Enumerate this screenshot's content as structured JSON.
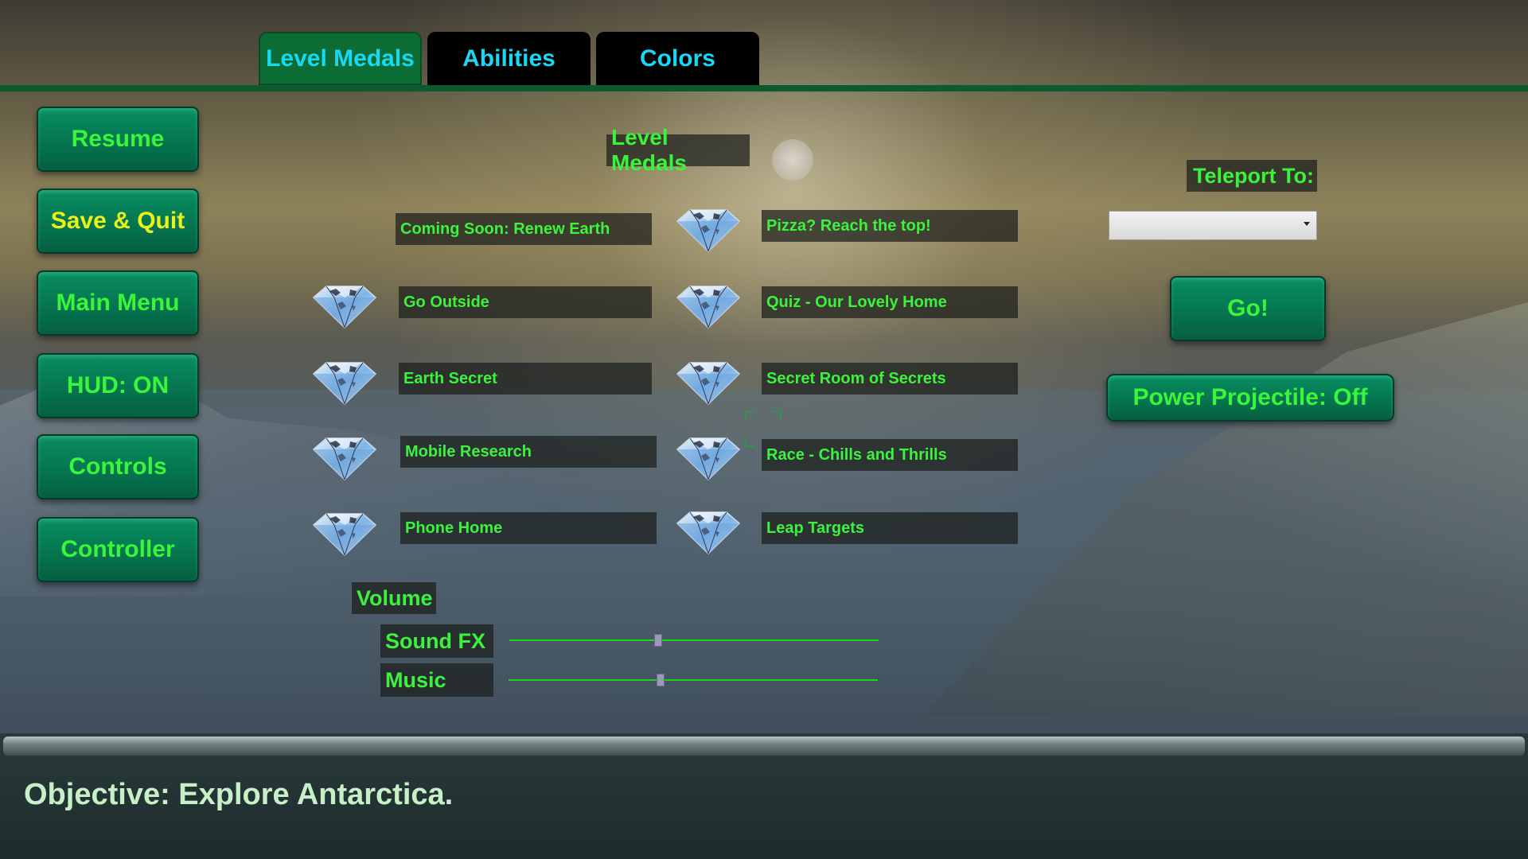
{
  "tabs": [
    {
      "label": "Level Medals",
      "active": true
    },
    {
      "label": "Abilities",
      "active": false
    },
    {
      "label": "Colors",
      "active": false
    }
  ],
  "side_menu": {
    "resume": "Resume",
    "save_quit": "Save & Quit",
    "main_menu": "Main Menu",
    "hud": "HUD: ON",
    "controls": "Controls",
    "controller": "Controller"
  },
  "medals": {
    "title": "Level Medals",
    "left": [
      {
        "label": "Coming Soon: Renew Earth",
        "earned": false
      },
      {
        "label": "Go Outside",
        "earned": true
      },
      {
        "label": "Earth Secret",
        "earned": true
      },
      {
        "label": "Mobile Research",
        "earned": true
      },
      {
        "label": "Phone Home",
        "earned": true
      }
    ],
    "right": [
      {
        "label": "Pizza? Reach the top!",
        "earned": true
      },
      {
        "label": "Quiz - Our Lovely Home",
        "earned": true
      },
      {
        "label": "Secret Room of Secrets",
        "earned": true
      },
      {
        "label": "Race - Chills and Thrills",
        "earned": true
      },
      {
        "label": "Leap Targets",
        "earned": true
      }
    ],
    "icon": "diamond-medal-icon"
  },
  "teleport": {
    "label": "Teleport To:",
    "selected": "",
    "go_label": "Go!"
  },
  "power_projectile": "Power Projectile: Off",
  "volume": {
    "label": "Volume",
    "sound_fx": {
      "label": "Sound FX",
      "level": 0.4
    },
    "music": {
      "label": "Music",
      "level": 0.41
    }
  },
  "objective": "Objective: Explore Antarctica.",
  "colors": {
    "label_text": "#3cf23c",
    "tab_text": "#18d8f5",
    "tab_active": "#0b6d33",
    "button_green": "#057a53",
    "yellow_text": "#e9f21a"
  }
}
